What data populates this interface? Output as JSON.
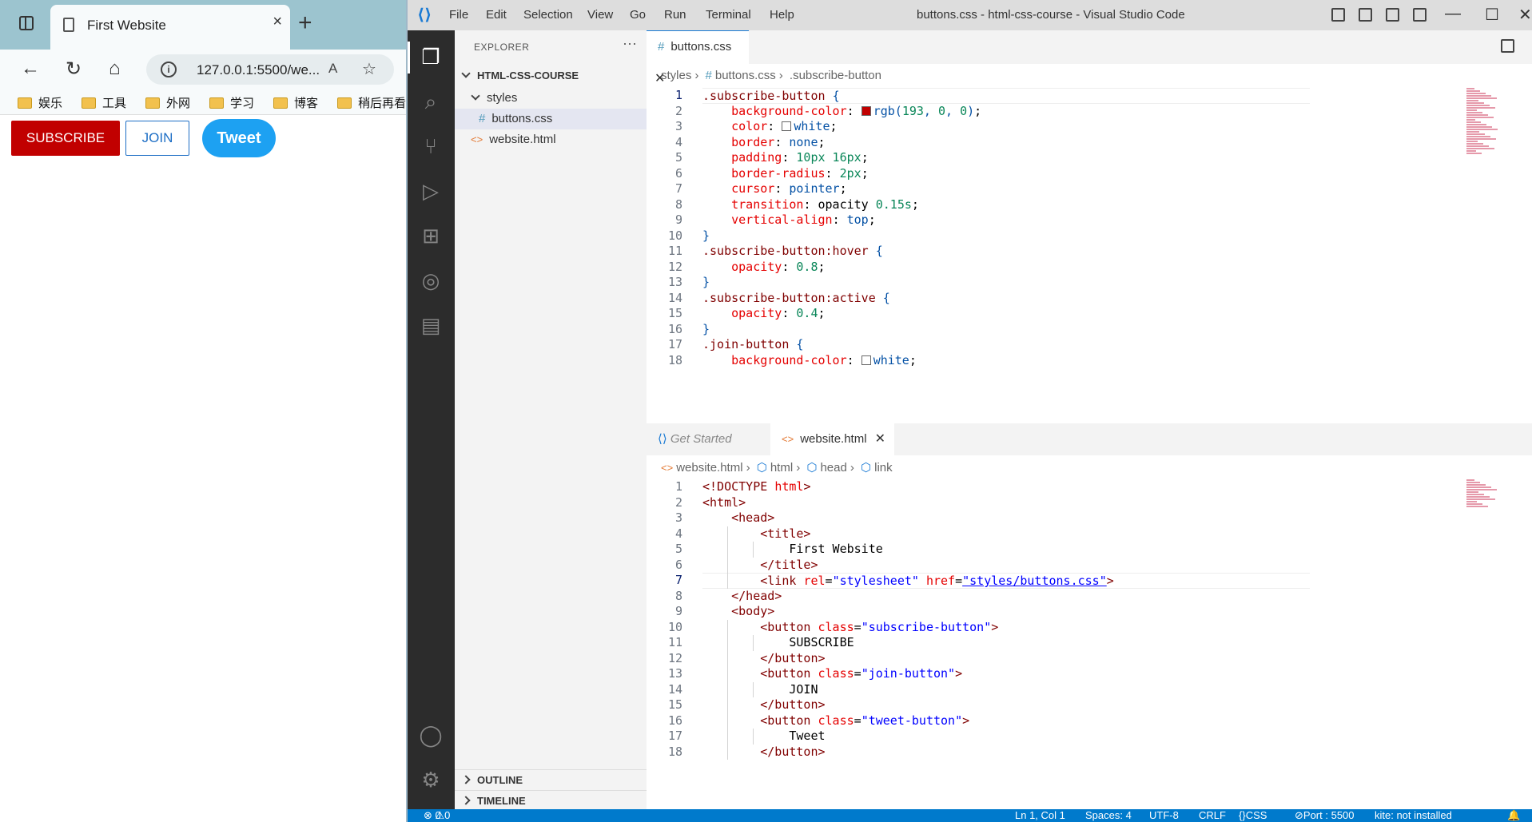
{
  "browser": {
    "tab_title": "First Website",
    "tab_close": "×",
    "new_tab": "+",
    "url": "127.0.0.1:5500/we...",
    "read_aloud": "A",
    "bookmarks": [
      "娱乐",
      "工具",
      "外网",
      "学习",
      "博客",
      "稍后再看"
    ],
    "buttons": {
      "subscribe": "SUBSCRIBE",
      "join": "JOIN",
      "tweet": "Tweet"
    }
  },
  "vscode": {
    "menu": [
      "File",
      "Edit",
      "Selection",
      "View",
      "Go",
      "Run",
      "Terminal",
      "Help"
    ],
    "title": "buttons.css - html-css-course - Visual Studio Code",
    "explorer_label": "EXPLORER",
    "explorer_more": "···",
    "tree": {
      "root": "HTML-CSS-COURSE",
      "folder": "styles",
      "files": [
        "buttons.css",
        "website.html"
      ]
    },
    "outline": "OUTLINE",
    "timeline": "TIMELINE",
    "top_tab": "buttons.css",
    "top_crumbs": [
      "styles",
      "buttons.css",
      ".subscribe-button"
    ],
    "bottom_tabs": [
      "Get Started",
      "website.html"
    ],
    "bottom_crumbs": [
      "website.html",
      "html",
      "head",
      "link"
    ],
    "status": {
      "errors": "0",
      "warnings": "0",
      "position": "Ln 1, Col 1",
      "spaces": "Spaces: 4",
      "encoding": "UTF-8",
      "eol": "CRLF",
      "lang": "CSS",
      "port": "Port : 5500",
      "kite": "kite: not installed"
    },
    "css_lines": [
      [
        {
          "t": ".subscribe-button ",
          "c": "sel-k"
        },
        {
          "t": "{",
          "c": "kw"
        }
      ],
      [
        {
          "t": "    "
        },
        {
          "t": "background-color",
          "c": "prop"
        },
        {
          "t": ": "
        },
        {
          "sw": "#c10000"
        },
        {
          "t": "rgb(",
          "c": "kw"
        },
        {
          "t": "193",
          "c": "num"
        },
        {
          "t": ", ",
          "c": "kw"
        },
        {
          "t": "0",
          "c": "num"
        },
        {
          "t": ", ",
          "c": "kw"
        },
        {
          "t": "0",
          "c": "num"
        },
        {
          "t": ")",
          "c": "kw"
        },
        {
          "t": ";"
        }
      ],
      [
        {
          "t": "    "
        },
        {
          "t": "color",
          "c": "prop"
        },
        {
          "t": ": "
        },
        {
          "sw": "#ffffff"
        },
        {
          "t": "white",
          "c": "kw"
        },
        {
          "t": ";"
        }
      ],
      [
        {
          "t": "    "
        },
        {
          "t": "border",
          "c": "prop"
        },
        {
          "t": ": "
        },
        {
          "t": "none",
          "c": "kw"
        },
        {
          "t": ";"
        }
      ],
      [
        {
          "t": "    "
        },
        {
          "t": "padding",
          "c": "prop"
        },
        {
          "t": ": "
        },
        {
          "t": "10px 16px",
          "c": "num"
        },
        {
          "t": ";"
        }
      ],
      [
        {
          "t": "    "
        },
        {
          "t": "border-radius",
          "c": "prop"
        },
        {
          "t": ": "
        },
        {
          "t": "2px",
          "c": "num"
        },
        {
          "t": ";"
        }
      ],
      [
        {
          "t": "    "
        },
        {
          "t": "cursor",
          "c": "prop"
        },
        {
          "t": ": "
        },
        {
          "t": "pointer",
          "c": "kw"
        },
        {
          "t": ";"
        }
      ],
      [
        {
          "t": "    "
        },
        {
          "t": "transition",
          "c": "prop"
        },
        {
          "t": ": opacity "
        },
        {
          "t": "0.15s",
          "c": "num"
        },
        {
          "t": ";"
        }
      ],
      [
        {
          "t": "    "
        },
        {
          "t": "vertical-align",
          "c": "prop"
        },
        {
          "t": ": "
        },
        {
          "t": "top",
          "c": "kw"
        },
        {
          "t": ";"
        }
      ],
      [
        {
          "t": "}",
          "c": "kw"
        }
      ],
      [
        {
          "t": ".subscribe-button:hover ",
          "c": "sel-k"
        },
        {
          "t": "{",
          "c": "kw"
        }
      ],
      [
        {
          "t": "    "
        },
        {
          "t": "opacity",
          "c": "prop"
        },
        {
          "t": ": "
        },
        {
          "t": "0.8",
          "c": "num"
        },
        {
          "t": ";"
        }
      ],
      [
        {
          "t": "}",
          "c": "kw"
        }
      ],
      [
        {
          "t": ".subscribe-button:active ",
          "c": "sel-k"
        },
        {
          "t": "{",
          "c": "kw"
        }
      ],
      [
        {
          "t": "    "
        },
        {
          "t": "opacity",
          "c": "prop"
        },
        {
          "t": ": "
        },
        {
          "t": "0.4",
          "c": "num"
        },
        {
          "t": ";"
        }
      ],
      [
        {
          "t": "}",
          "c": "kw"
        }
      ],
      [
        {
          "t": ".join-button ",
          "c": "sel-k"
        },
        {
          "t": "{",
          "c": "kw"
        }
      ],
      [
        {
          "t": "    "
        },
        {
          "t": "background-color",
          "c": "prop"
        },
        {
          "t": ": "
        },
        {
          "sw": "#ffffff"
        },
        {
          "t": "white",
          "c": "kw"
        },
        {
          "t": ";"
        }
      ]
    ],
    "html_lines": [
      [
        {
          "t": "<!DOCTYPE ",
          "c": "tag"
        },
        {
          "t": "html",
          "c": "attr"
        },
        {
          "t": ">",
          "c": "tag"
        }
      ],
      [
        {
          "t": "<html>",
          "c": "tag"
        }
      ],
      [
        {
          "t": "    "
        },
        {
          "t": "<head>",
          "c": "tag"
        }
      ],
      [
        {
          "t": "        "
        },
        {
          "t": "<title>",
          "c": "tag"
        }
      ],
      [
        {
          "t": "            First Website"
        }
      ],
      [
        {
          "t": "        "
        },
        {
          "t": "</title>",
          "c": "tag"
        }
      ],
      [
        {
          "t": "        "
        },
        {
          "t": "<link ",
          "c": "tag"
        },
        {
          "t": "rel",
          "c": "attr"
        },
        {
          "t": "="
        },
        {
          "t": "\"stylesheet\"",
          "c": "str"
        },
        {
          "t": " "
        },
        {
          "t": "href",
          "c": "attr"
        },
        {
          "t": "="
        },
        {
          "t": "\"styles/buttons.css\"",
          "c": "str"
        },
        {
          "t": ">",
          "c": "tag"
        }
      ],
      [
        {
          "t": "    "
        },
        {
          "t": "</head>",
          "c": "tag"
        }
      ],
      [
        {
          "t": "    "
        },
        {
          "t": "<body>",
          "c": "tag"
        }
      ],
      [
        {
          "t": "        "
        },
        {
          "t": "<button ",
          "c": "tag"
        },
        {
          "t": "class",
          "c": "attr"
        },
        {
          "t": "="
        },
        {
          "t": "\"subscribe-button\"",
          "c": "str"
        },
        {
          "t": ">",
          "c": "tag"
        }
      ],
      [
        {
          "t": "            SUBSCRIBE"
        }
      ],
      [
        {
          "t": "        "
        },
        {
          "t": "</button>",
          "c": "tag"
        }
      ],
      [
        {
          "t": "        "
        },
        {
          "t": "<button ",
          "c": "tag"
        },
        {
          "t": "class",
          "c": "attr"
        },
        {
          "t": "="
        },
        {
          "t": "\"join-button\"",
          "c": "str"
        },
        {
          "t": ">",
          "c": "tag"
        }
      ],
      [
        {
          "t": "            JOIN"
        }
      ],
      [
        {
          "t": "        "
        },
        {
          "t": "</button>",
          "c": "tag"
        }
      ],
      [
        {
          "t": "        "
        },
        {
          "t": "<button ",
          "c": "tag"
        },
        {
          "t": "class",
          "c": "attr"
        },
        {
          "t": "="
        },
        {
          "t": "\"tweet-button\"",
          "c": "str"
        },
        {
          "t": ">",
          "c": "tag"
        }
      ],
      [
        {
          "t": "            Tweet"
        }
      ],
      [
        {
          "t": "        "
        },
        {
          "t": "</button>",
          "c": "tag"
        }
      ]
    ]
  }
}
